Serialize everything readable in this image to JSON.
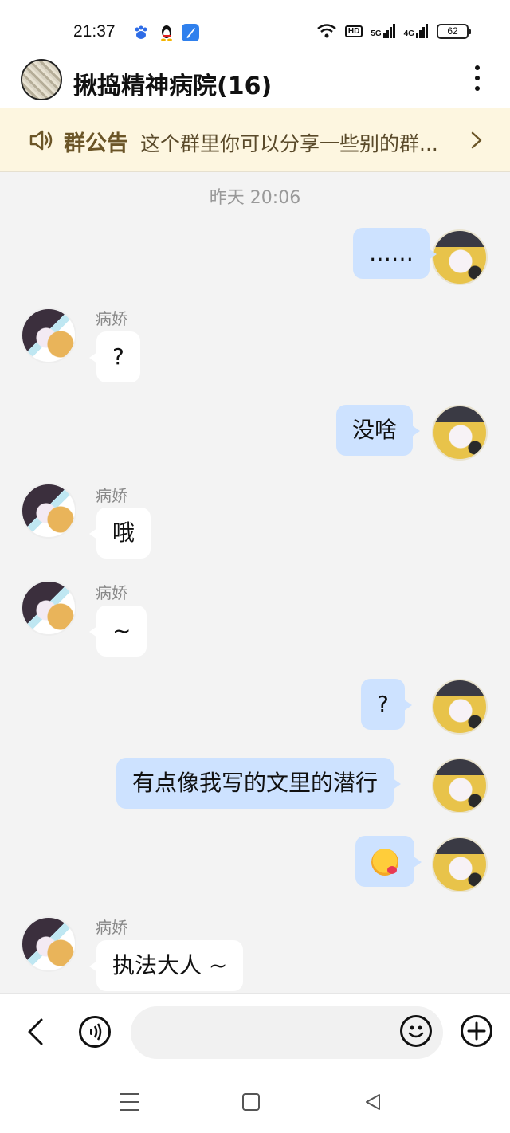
{
  "status_bar": {
    "time": "21:37",
    "network_hd": "HD",
    "network_5g": "5G",
    "network_4g": "4G",
    "battery": "62",
    "app_icons": [
      "baidu-paw-icon",
      "qq-penguin-icon",
      "blue-feather-icon"
    ]
  },
  "header": {
    "title": "揪捣精神病院(16)"
  },
  "announcement": {
    "label": "群公告",
    "text": "这个群里你可以分享一些别的群..."
  },
  "chat": {
    "timestamp": "昨天 20:06",
    "messages": [
      {
        "side": "me",
        "text": "……"
      },
      {
        "side": "other",
        "sender": "病娇",
        "text": "?"
      },
      {
        "side": "me",
        "text": "没啥"
      },
      {
        "side": "other",
        "sender": "病娇",
        "text": "哦"
      },
      {
        "side": "other",
        "sender": "病娇",
        "text": "~"
      },
      {
        "side": "me",
        "text": "?"
      },
      {
        "side": "me",
        "text": "有点像我写的文里的潜行"
      },
      {
        "side": "me",
        "text": "",
        "emoji": "yummy-face-emoji"
      },
      {
        "side": "other",
        "sender": "病娇",
        "text": "执法大人 ~"
      }
    ]
  },
  "input_bar": {
    "placeholder": ""
  },
  "colors": {
    "my_bubble": "#cde2ff",
    "other_bubble": "#ffffff",
    "announcement_bg": "#fdf6e0",
    "announcement_text": "#6b5527",
    "chat_bg": "#f3f3f3"
  }
}
